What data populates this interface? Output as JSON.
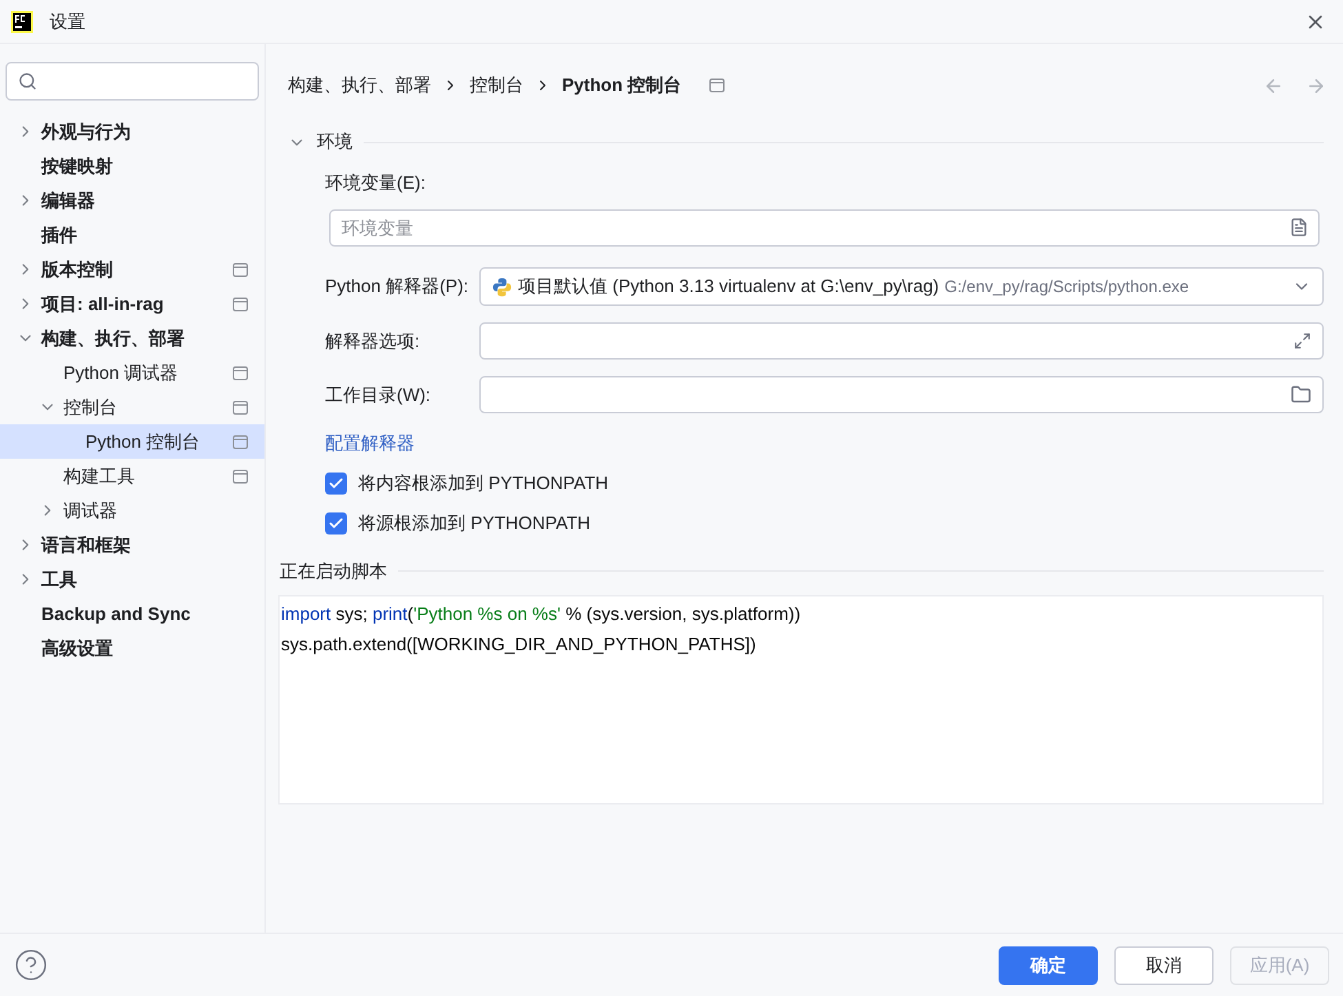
{
  "window": {
    "title": "设置"
  },
  "sidebar": {
    "items": [
      {
        "label": "外观与行为",
        "expanded": false,
        "selected": false
      },
      {
        "label": "按键映射",
        "selected": false
      },
      {
        "label": "编辑器",
        "expanded": false,
        "selected": false
      },
      {
        "label": "插件",
        "selected": false
      },
      {
        "label": "版本控制",
        "expanded": false,
        "selected": false,
        "project_scope": true
      },
      {
        "label": "项目: all-in-rag",
        "expanded": false,
        "selected": false,
        "project_scope": true
      },
      {
        "label": "构建、执行、部署",
        "expanded": true,
        "selected": false,
        "children": [
          {
            "label": "Python 调试器",
            "selected": false,
            "project_scope": true
          },
          {
            "label": "控制台",
            "expanded": true,
            "selected": false,
            "project_scope": true,
            "children": [
              {
                "label": "Python 控制台",
                "selected": true,
                "project_scope": true
              }
            ]
          },
          {
            "label": "构建工具",
            "selected": false,
            "project_scope": true
          },
          {
            "label": "调试器",
            "expanded": false,
            "selected": false
          }
        ]
      },
      {
        "label": "语言和框架",
        "expanded": false,
        "selected": false
      },
      {
        "label": "工具",
        "expanded": false,
        "selected": false
      },
      {
        "label": "Backup and Sync",
        "selected": false
      },
      {
        "label": "高级设置",
        "selected": false
      }
    ]
  },
  "breadcrumb": [
    "构建、执行、部署",
    "控制台",
    "Python 控制台"
  ],
  "environment": {
    "title": "环境",
    "expanded": true,
    "env_vars": {
      "label": "环境变量(E):",
      "placeholder": "环境变量"
    },
    "interpreter": {
      "label": "Python 解释器(P):",
      "value": "项目默认值 (Python 3.13 virtualenv at G:\\env_py\\rag)",
      "path": "G:/env_py/rag/Scripts/python.exe"
    },
    "options": {
      "label": "解释器选项:"
    },
    "workdir": {
      "label": "工作目录(W):"
    },
    "link": "配置解释器",
    "checkboxes": [
      {
        "label": "将内容根添加到 PYTHONPATH",
        "checked": true
      },
      {
        "label": "将源根添加到 PYTHONPATH",
        "checked": true
      }
    ]
  },
  "startup": {
    "title": "正在启动脚本",
    "lines": [
      [
        {
          "kind": "keyword",
          "text": "import"
        },
        {
          "kind": "plain",
          "text": " sys; "
        },
        {
          "kind": "keyword",
          "text": "print"
        },
        {
          "kind": "plain",
          "text": "("
        },
        {
          "kind": "string",
          "text": "'Python %s on %s'"
        },
        {
          "kind": "plain",
          "text": " % (sys.version, sys.platform))"
        }
      ],
      [
        {
          "kind": "plain",
          "text": "sys.path.extend([WORKING_DIR_AND_PYTHON_PATHS])"
        }
      ]
    ]
  },
  "buttons": [
    {
      "label": "确定",
      "kind": "primary",
      "disabled": false
    },
    {
      "label": "取消",
      "kind": "normal",
      "disabled": false
    },
    {
      "label": "应用(A)",
      "kind": "normal",
      "disabled": true
    }
  ]
}
